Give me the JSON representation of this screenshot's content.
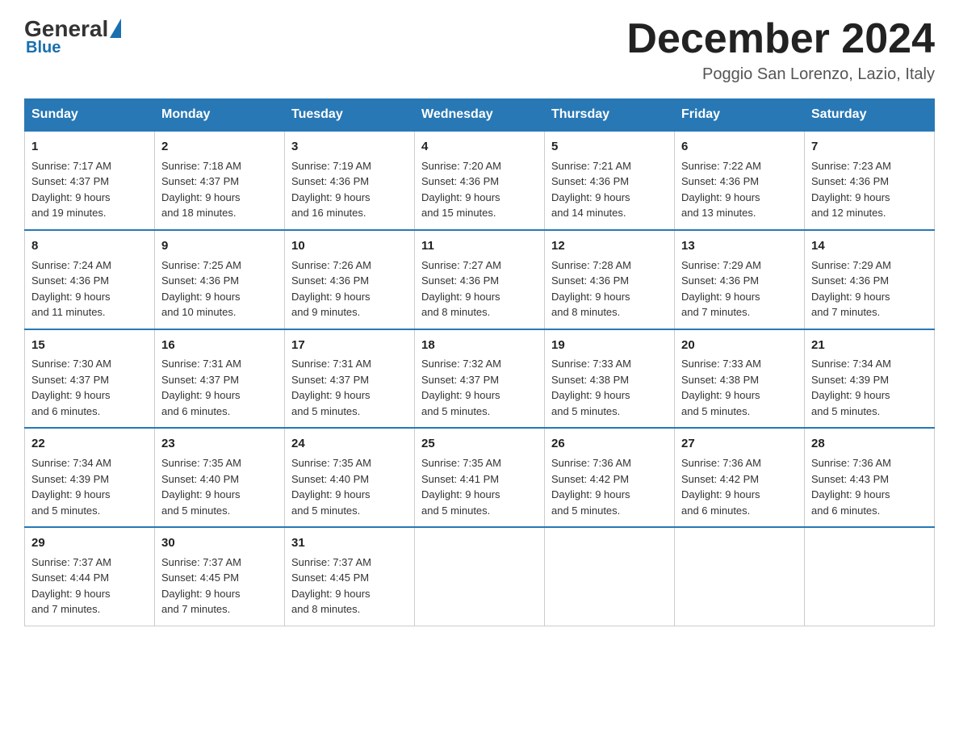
{
  "header": {
    "logo_general": "General",
    "logo_blue": "Blue",
    "month_title": "December 2024",
    "location": "Poggio San Lorenzo, Lazio, Italy"
  },
  "days_of_week": [
    "Sunday",
    "Monday",
    "Tuesday",
    "Wednesday",
    "Thursday",
    "Friday",
    "Saturday"
  ],
  "weeks": [
    [
      {
        "day": "1",
        "sunrise": "7:17 AM",
        "sunset": "4:37 PM",
        "daylight": "9 hours and 19 minutes."
      },
      {
        "day": "2",
        "sunrise": "7:18 AM",
        "sunset": "4:37 PM",
        "daylight": "9 hours and 18 minutes."
      },
      {
        "day": "3",
        "sunrise": "7:19 AM",
        "sunset": "4:36 PM",
        "daylight": "9 hours and 16 minutes."
      },
      {
        "day": "4",
        "sunrise": "7:20 AM",
        "sunset": "4:36 PM",
        "daylight": "9 hours and 15 minutes."
      },
      {
        "day": "5",
        "sunrise": "7:21 AM",
        "sunset": "4:36 PM",
        "daylight": "9 hours and 14 minutes."
      },
      {
        "day": "6",
        "sunrise": "7:22 AM",
        "sunset": "4:36 PM",
        "daylight": "9 hours and 13 minutes."
      },
      {
        "day": "7",
        "sunrise": "7:23 AM",
        "sunset": "4:36 PM",
        "daylight": "9 hours and 12 minutes."
      }
    ],
    [
      {
        "day": "8",
        "sunrise": "7:24 AM",
        "sunset": "4:36 PM",
        "daylight": "9 hours and 11 minutes."
      },
      {
        "day": "9",
        "sunrise": "7:25 AM",
        "sunset": "4:36 PM",
        "daylight": "9 hours and 10 minutes."
      },
      {
        "day": "10",
        "sunrise": "7:26 AM",
        "sunset": "4:36 PM",
        "daylight": "9 hours and 9 minutes."
      },
      {
        "day": "11",
        "sunrise": "7:27 AM",
        "sunset": "4:36 PM",
        "daylight": "9 hours and 8 minutes."
      },
      {
        "day": "12",
        "sunrise": "7:28 AM",
        "sunset": "4:36 PM",
        "daylight": "9 hours and 8 minutes."
      },
      {
        "day": "13",
        "sunrise": "7:29 AM",
        "sunset": "4:36 PM",
        "daylight": "9 hours and 7 minutes."
      },
      {
        "day": "14",
        "sunrise": "7:29 AM",
        "sunset": "4:36 PM",
        "daylight": "9 hours and 7 minutes."
      }
    ],
    [
      {
        "day": "15",
        "sunrise": "7:30 AM",
        "sunset": "4:37 PM",
        "daylight": "9 hours and 6 minutes."
      },
      {
        "day": "16",
        "sunrise": "7:31 AM",
        "sunset": "4:37 PM",
        "daylight": "9 hours and 6 minutes."
      },
      {
        "day": "17",
        "sunrise": "7:31 AM",
        "sunset": "4:37 PM",
        "daylight": "9 hours and 5 minutes."
      },
      {
        "day": "18",
        "sunrise": "7:32 AM",
        "sunset": "4:37 PM",
        "daylight": "9 hours and 5 minutes."
      },
      {
        "day": "19",
        "sunrise": "7:33 AM",
        "sunset": "4:38 PM",
        "daylight": "9 hours and 5 minutes."
      },
      {
        "day": "20",
        "sunrise": "7:33 AM",
        "sunset": "4:38 PM",
        "daylight": "9 hours and 5 minutes."
      },
      {
        "day": "21",
        "sunrise": "7:34 AM",
        "sunset": "4:39 PM",
        "daylight": "9 hours and 5 minutes."
      }
    ],
    [
      {
        "day": "22",
        "sunrise": "7:34 AM",
        "sunset": "4:39 PM",
        "daylight": "9 hours and 5 minutes."
      },
      {
        "day": "23",
        "sunrise": "7:35 AM",
        "sunset": "4:40 PM",
        "daylight": "9 hours and 5 minutes."
      },
      {
        "day": "24",
        "sunrise": "7:35 AM",
        "sunset": "4:40 PM",
        "daylight": "9 hours and 5 minutes."
      },
      {
        "day": "25",
        "sunrise": "7:35 AM",
        "sunset": "4:41 PM",
        "daylight": "9 hours and 5 minutes."
      },
      {
        "day": "26",
        "sunrise": "7:36 AM",
        "sunset": "4:42 PM",
        "daylight": "9 hours and 5 minutes."
      },
      {
        "day": "27",
        "sunrise": "7:36 AM",
        "sunset": "4:42 PM",
        "daylight": "9 hours and 6 minutes."
      },
      {
        "day": "28",
        "sunrise": "7:36 AM",
        "sunset": "4:43 PM",
        "daylight": "9 hours and 6 minutes."
      }
    ],
    [
      {
        "day": "29",
        "sunrise": "7:37 AM",
        "sunset": "4:44 PM",
        "daylight": "9 hours and 7 minutes."
      },
      {
        "day": "30",
        "sunrise": "7:37 AM",
        "sunset": "4:45 PM",
        "daylight": "9 hours and 7 minutes."
      },
      {
        "day": "31",
        "sunrise": "7:37 AM",
        "sunset": "4:45 PM",
        "daylight": "9 hours and 8 minutes."
      },
      null,
      null,
      null,
      null
    ]
  ],
  "labels": {
    "sunrise_prefix": "Sunrise: ",
    "sunset_prefix": "Sunset: ",
    "daylight_prefix": "Daylight: "
  }
}
